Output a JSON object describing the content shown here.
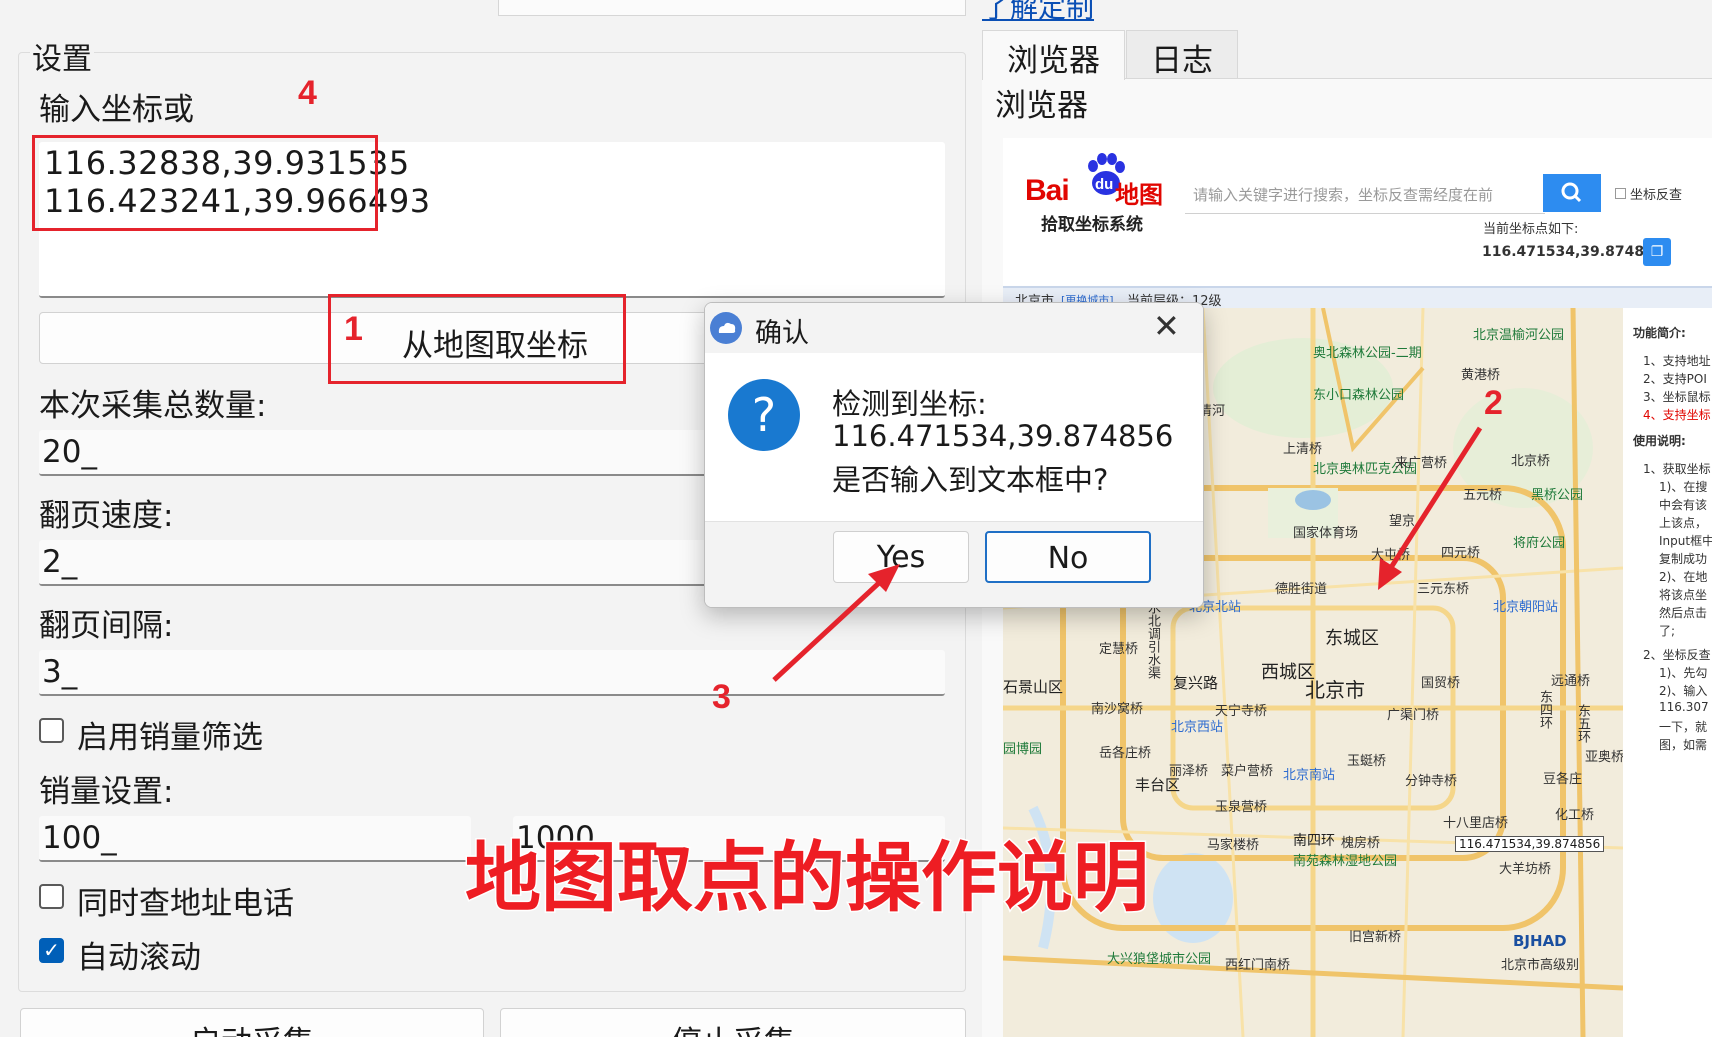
{
  "top_link": "了解定制",
  "settings": {
    "group_title": "设置",
    "coord_label": "输入坐标或",
    "coord_lines": [
      "116.32838,39.931535",
      "116.423241,39.966493"
    ],
    "pick_button": "从地图取坐标",
    "total_label": "本次采集总数量:",
    "total_value": "20_",
    "speed_label": "翻页速度:",
    "speed_value": "2_",
    "interval_label": "翻页间隔:",
    "interval_value": "3_",
    "sales_filter_label": "启用销量筛选",
    "sales_filter_checked": false,
    "sales_setting_label": "销量设置:",
    "sales_min": "100_",
    "sales_max": "1000",
    "query_phone_label": "同时查地址电话",
    "query_phone_checked": false,
    "auto_scroll_label": "自动滚动",
    "auto_scroll_checked": true,
    "start_button": "启动采集",
    "stop_button": "停止采集"
  },
  "browser": {
    "tabs": [
      {
        "label": "浏览器",
        "active": true
      },
      {
        "label": "日志",
        "active": false
      }
    ],
    "pane_title": "浏览器",
    "logo_bai": "Bai",
    "logo_du": "du",
    "logo_map": "地图",
    "logo_sub": "拾取坐标系统",
    "search_placeholder": "请输入关键字进行搜索，坐标反查需经度在前",
    "reverse_label": "坐标反查",
    "current_label": "当前坐标点如下:",
    "current_value": "116.471534,39.874856",
    "city_label": "北京市",
    "city_switch": "[更换城市]",
    "zoom_label": "当前层级：12级",
    "coord_tip": "116.471534,39.874856",
    "side_info": [
      "功能简介:",
      "1、支持地址",
      "2、支持POI",
      "3、坐标鼠标",
      "4、支持坐标",
      "使用说明:",
      "1、获取坐标",
      "1)、在搜",
      "中会有该",
      "上该点，",
      "Input框中",
      "复制成功",
      "2)、在地",
      "将该点坐",
      "然后点击",
      "了;",
      "2、坐标反查",
      "1)、先勾",
      "2)、输入",
      "116.307",
      "一下，就",
      "图，如需"
    ],
    "map_labels": {
      "l01": "北京温榆河公园",
      "l02": "奥北森林公园-二期",
      "l03": "黄港桥",
      "l04": "东小口森林公园",
      "l05": "清河",
      "l06": "上清桥",
      "l07": "北京奥林匹克公园",
      "l08": "来广营桥",
      "l09": "北京桥",
      "l10": "五元桥",
      "l11": "黑桥公园",
      "l12": "国家体育场",
      "l13": "望京",
      "l14": "将府公园",
      "l15": "大屯桥",
      "l16": "四元桥",
      "l17": "德胜街道",
      "l18": "三元东桥",
      "l19": "北京北站",
      "l20": "北京朝阳站",
      "l21": "东城区",
      "l22": "定慧桥",
      "l23": "西城区",
      "l24": "复兴路",
      "l25": "北京市",
      "l26": "国贸桥",
      "l27": "远通桥",
      "l28": "石景山区",
      "l29": "南沙窝桥",
      "l30": "天宁寺桥",
      "l31": "广渠门桥",
      "l32": "北京西站",
      "l33": "园博园",
      "l34": "岳各庄桥",
      "l35": "丽泽桥",
      "l36": "菜户营桥",
      "l37": "北京南站",
      "l38": "玉蜓桥",
      "l39": "分钟寺桥",
      "l40": "丰台区",
      "l41": "玉泉营桥",
      "l42": "十八里店桥",
      "l43": "化工桥",
      "l44": "南四环",
      "l45": "马家楼桥",
      "l46": "槐房桥",
      "l47": "南苑森林湿地公园",
      "l48": "大羊坊桥",
      "l49": "大兴狼垡城市公园",
      "l50": "西红门南桥",
      "l51": "旧宫新桥",
      "l52": "北京市高级别",
      "l53": "东四环",
      "l54": "东五环",
      "l55": "亚奥桥",
      "l56": "豆各庄",
      "l57": "南水北调引水渠",
      "l58": "BJHAD"
    }
  },
  "dialog": {
    "title": "确认",
    "message_line1": "检测到坐标:",
    "message_line2": "116.471534,39.874856",
    "message_line3": "是否输入到文本框中?",
    "yes": "Yes",
    "no": "No"
  },
  "annotations": {
    "n1": "1",
    "n2": "2",
    "n3": "3",
    "n4": "4",
    "headline": "地图取点的操作说明",
    "color": "#e5232c"
  }
}
